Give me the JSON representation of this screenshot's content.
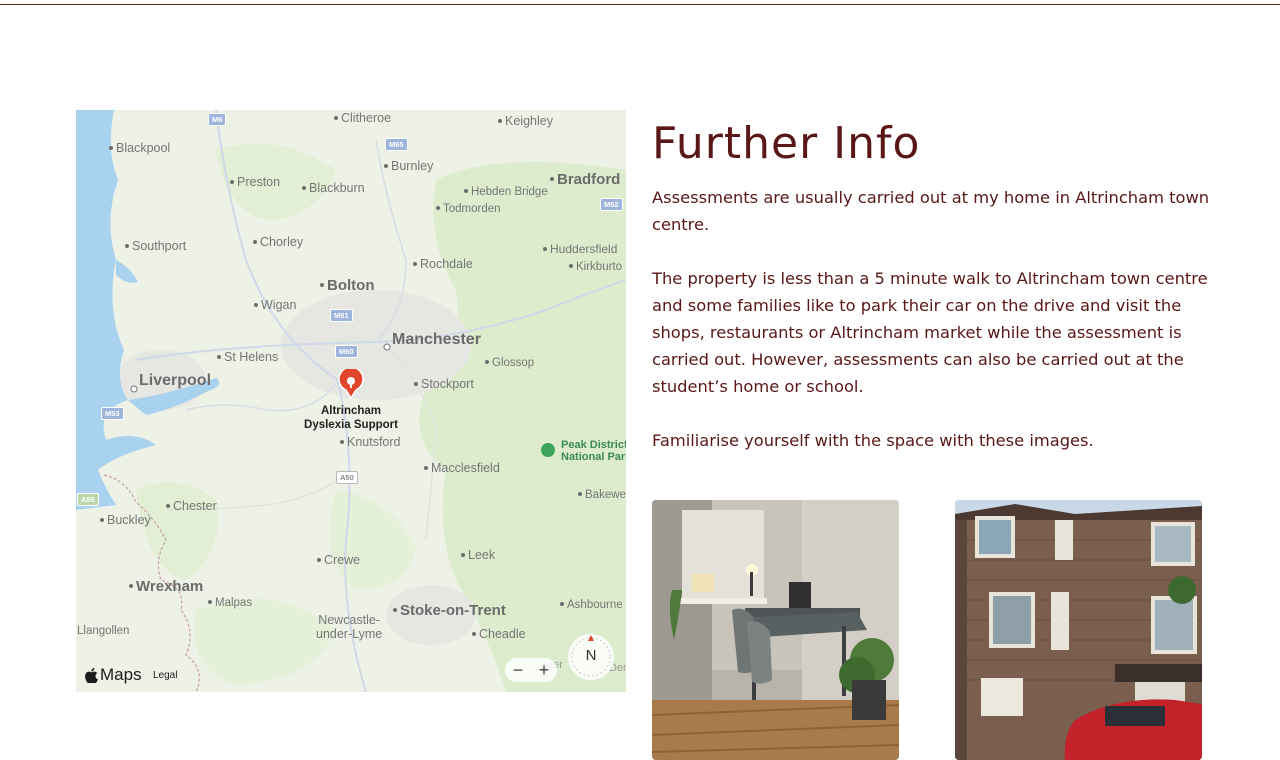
{
  "map": {
    "places": [
      {
        "name": "Blackpool",
        "style": "normal"
      },
      {
        "name": "Clitheroe",
        "style": "normal"
      },
      {
        "name": "Keighley",
        "style": "normal"
      },
      {
        "name": "Preston",
        "style": "normal"
      },
      {
        "name": "Blackburn",
        "style": "normal"
      },
      {
        "name": "Burnley",
        "style": "normal"
      },
      {
        "name": "Bradford",
        "style": "big"
      },
      {
        "name": "Hebden Bridge",
        "style": "normal"
      },
      {
        "name": "Todmorden",
        "style": "normal"
      },
      {
        "name": "Southport",
        "style": "normal"
      },
      {
        "name": "Chorley",
        "style": "normal"
      },
      {
        "name": "Huddersfield",
        "style": "normal"
      },
      {
        "name": "Rochdale",
        "style": "normal"
      },
      {
        "name": "Kirkburto",
        "style": "normal"
      },
      {
        "name": "Bolton",
        "style": "big"
      },
      {
        "name": "Wigan",
        "style": "normal"
      },
      {
        "name": "Manchester",
        "style": "bigger"
      },
      {
        "name": "St Helens",
        "style": "normal"
      },
      {
        "name": "Glossop",
        "style": "normal"
      },
      {
        "name": "Liverpool",
        "style": "bigger"
      },
      {
        "name": "Stockport",
        "style": "normal"
      },
      {
        "name": "Knutsford",
        "style": "normal"
      },
      {
        "name": "Macclesfield",
        "style": "normal"
      },
      {
        "name": "Chester",
        "style": "normal"
      },
      {
        "name": "Bakewe",
        "style": "normal"
      },
      {
        "name": "Buckley",
        "style": "normal"
      },
      {
        "name": "Crewe",
        "style": "normal"
      },
      {
        "name": "Leek",
        "style": "normal"
      },
      {
        "name": "Wrexham",
        "style": "big"
      },
      {
        "name": "Malpas",
        "style": "normal"
      },
      {
        "name": "Stoke-on-Trent",
        "style": "big"
      },
      {
        "name": "Ashbourne",
        "style": "normal"
      },
      {
        "name": "Cheadle",
        "style": "normal"
      },
      {
        "name": "Llangollen",
        "style": "normal"
      }
    ],
    "newcastle_label": "Newcastle-\nunder-Lyme",
    "park_label": "Peak District\nNational Park",
    "road_shields": [
      "M6",
      "M65",
      "M62",
      "M61",
      "M60",
      "M53",
      "A50",
      "A55"
    ],
    "pin_label": "Altrincham\nDyslexia Support",
    "maps_brand": "Maps",
    "legal_label": "Legal",
    "zoom_out_label": "−",
    "zoom_in_label": "+",
    "compass_label": "N",
    "edge_fragments": [
      "eter",
      "Der"
    ]
  },
  "content": {
    "heading": "Further Info",
    "paragraph_1": "Assessments are usually carried out at my home in Altrincham town centre.",
    "paragraph_2": "The property is less than a 5 minute walk to Altrincham town centre and some families like to park their car on the drive and visit the shops, restaurants or Altrincham market while the assessment is carried out. However, assessments can also be carried out at the student’s home or school.",
    "paragraph_3": "Familiarise yourself with the space with these images."
  },
  "colors": {
    "text": "#5a1717",
    "rule": "#6b2626",
    "map_water": "#a9d2ef",
    "map_land": "#eef1e6",
    "map_green": "#dceccc",
    "pin": "#e2452d"
  },
  "icons": {
    "pin": "location-pin-icon",
    "compass": "compass-icon",
    "apple": "apple-logo-icon",
    "park": "park-icon"
  }
}
